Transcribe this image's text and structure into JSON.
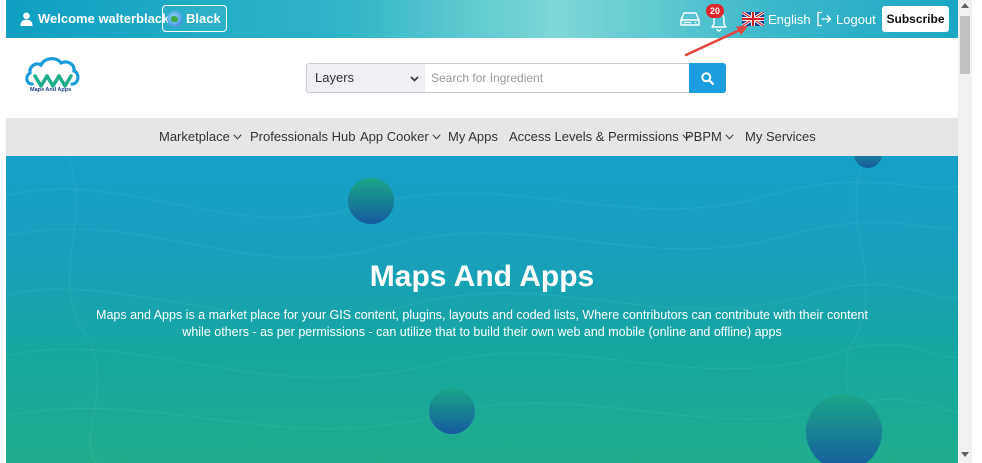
{
  "topbar": {
    "welcome": "Welcome walterblack",
    "theme_label": "Black",
    "notification_count": "20",
    "language": "English",
    "logout": "Logout",
    "subscribe": "Subscribe"
  },
  "header": {
    "logo_text": "Maps And Apps",
    "search": {
      "category": "Layers",
      "placeholder": "Search for Ingredient"
    }
  },
  "nav": {
    "items": [
      {
        "label": "Marketplace",
        "dropdown": true
      },
      {
        "label": "Professionals Hub",
        "dropdown": false
      },
      {
        "label": "App Cooker",
        "dropdown": true
      },
      {
        "label": "My Apps",
        "dropdown": false
      },
      {
        "label": "Access Levels & Permissions",
        "dropdown": true
      },
      {
        "label": "PBPM",
        "dropdown": true
      },
      {
        "label": "My Services",
        "dropdown": false
      }
    ]
  },
  "hero": {
    "title": "Maps And Apps",
    "description": "Maps and Apps is a market place for your GIS content, plugins, layouts and coded lists, Where contributors can contribute with their content while others - as per permissions - can utilize that to build their own web and mobile (online and offline) apps"
  },
  "colors": {
    "topbar_start": "#0e9fc2",
    "topbar_mid": "#7fd8d6",
    "search_button": "#1b9ee0",
    "badge": "#e0262a",
    "nav_bg": "#e6e6e6",
    "hero_top": "#15a1c7",
    "hero_bottom": "#1fae8c",
    "annotation_arrow": "#e2453f"
  }
}
